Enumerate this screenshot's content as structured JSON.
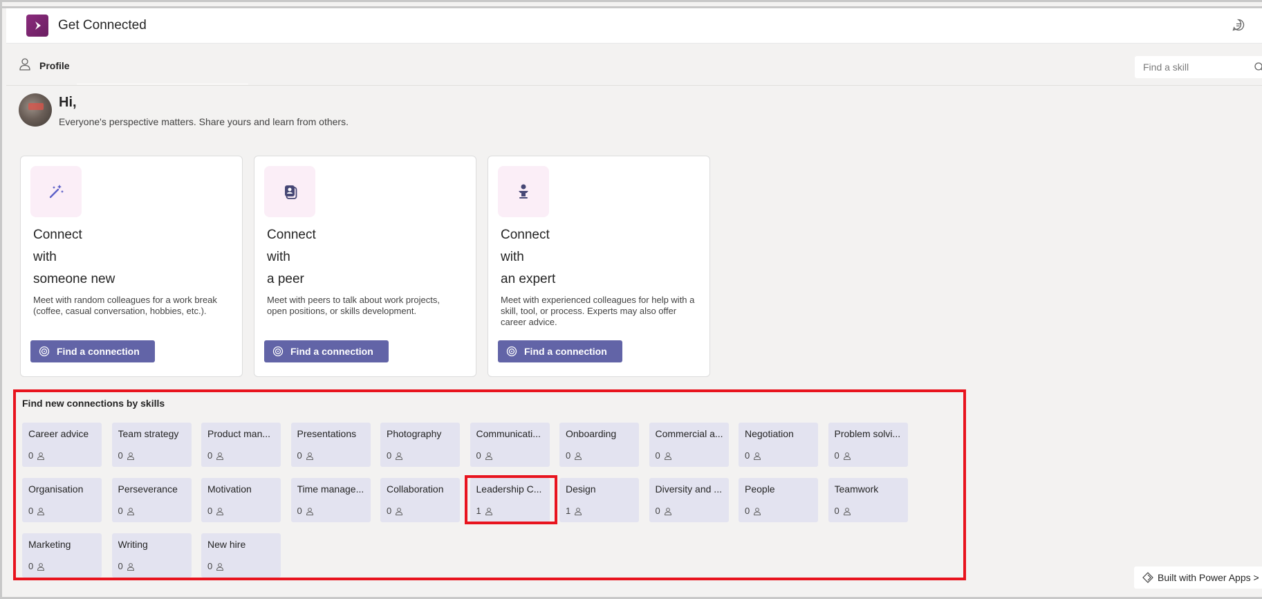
{
  "app": {
    "title": "Get Connected",
    "chat_icon": "chat-icon",
    "logo_icon": "power-apps-logo-icon"
  },
  "nav": {
    "profile_label": "Profile",
    "profile_icon": "person-icon"
  },
  "search": {
    "placeholder": "Find a skill",
    "icon": "search-icon"
  },
  "greeting": {
    "hi": "Hi,",
    "tagline": "Everyone's perspective matters. Share yours and learn from others."
  },
  "cards": [
    {
      "title_lines": [
        "Connect",
        "with",
        "someone new"
      ],
      "description": "Meet with random colleagues for a work break (coffee, casual conversation, hobbies, etc.).",
      "button": "Find a connection",
      "icon": "magic-wand-icon"
    },
    {
      "title_lines": [
        "Connect",
        "with",
        "a peer"
      ],
      "description": "Meet with peers to talk about work projects, open positions, or skills development.",
      "button": "Find a connection",
      "icon": "contact-card-icon"
    },
    {
      "title_lines": [
        "Connect",
        "with",
        "an expert"
      ],
      "description": "Meet with experienced colleagues for help with a skill, tool, or process. Experts may also offer career advice.",
      "button": "Find a connection",
      "icon": "mentor-icon"
    }
  ],
  "skills": {
    "heading": "Find new connections by skills",
    "items": [
      {
        "name": "Career advice",
        "count": "0"
      },
      {
        "name": "Team strategy",
        "count": "0"
      },
      {
        "name": "Product man...",
        "count": "0"
      },
      {
        "name": "Presentations",
        "count": "0"
      },
      {
        "name": "Photography",
        "count": "0"
      },
      {
        "name": "Communicati...",
        "count": "0"
      },
      {
        "name": "Onboarding",
        "count": "0"
      },
      {
        "name": "Commercial a...",
        "count": "0"
      },
      {
        "name": "Negotiation",
        "count": "0"
      },
      {
        "name": "Problem solvi...",
        "count": "0"
      },
      {
        "name": "Organisation",
        "count": "0"
      },
      {
        "name": "Perseverance",
        "count": "0"
      },
      {
        "name": "Motivation",
        "count": "0"
      },
      {
        "name": "Time manage...",
        "count": "0"
      },
      {
        "name": "Collaboration",
        "count": "0"
      },
      {
        "name": "Leadership C...",
        "count": "1",
        "highlighted": true
      },
      {
        "name": "Design",
        "count": "1"
      },
      {
        "name": "Diversity and ...",
        "count": "0"
      },
      {
        "name": "People",
        "count": "0"
      },
      {
        "name": "Teamwork",
        "count": "0"
      },
      {
        "name": "Marketing",
        "count": "0"
      },
      {
        "name": "Writing",
        "count": "0"
      },
      {
        "name": "New hire",
        "count": "0"
      }
    ]
  },
  "footer": {
    "built_with": "Built with Power Apps >"
  },
  "colors": {
    "accent": "#6264a7",
    "highlight": "#e8141e",
    "tile_bg": "#e3e3f0",
    "app_icon": "#742774"
  }
}
